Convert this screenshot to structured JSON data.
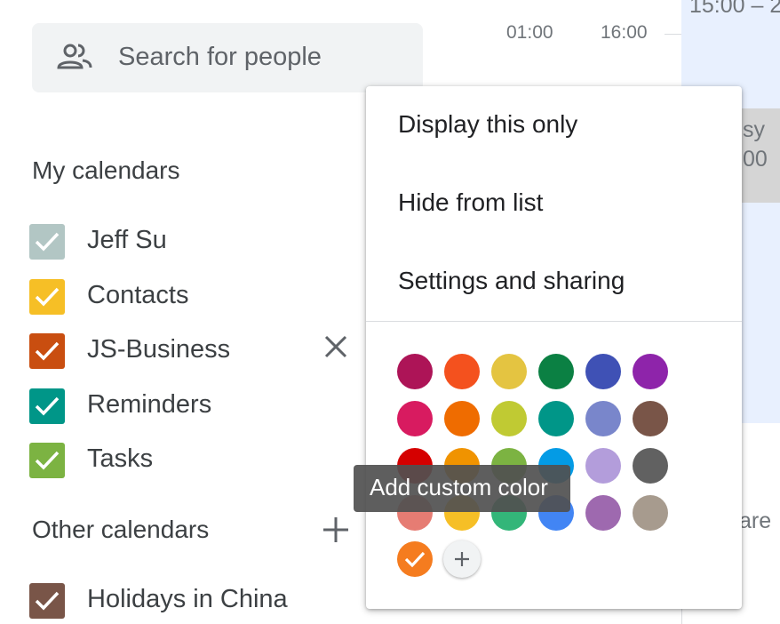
{
  "search": {
    "placeholder": "Search for people"
  },
  "timeline": {
    "labels": [
      "01:00",
      "16:00"
    ],
    "top_fragment": "15:00 – 2",
    "event_fragment_1": "sy",
    "event_fragment_2": "00",
    "bottom_fragment": "are"
  },
  "my_calendars": {
    "title": "My calendars",
    "items": [
      {
        "label": "Jeff Su",
        "color": "#b2c6c4",
        "checked": true
      },
      {
        "label": "Contacts",
        "color": "#f6bf26",
        "checked": true
      },
      {
        "label": "JS-Business",
        "color": "#c94e10",
        "checked": true
      },
      {
        "label": "Reminders",
        "color": "#009688",
        "checked": true
      },
      {
        "label": "Tasks",
        "color": "#7cb342",
        "checked": true
      }
    ]
  },
  "other_calendars": {
    "title": "Other calendars",
    "items": [
      {
        "label": "Holidays in China",
        "color": "#795548",
        "checked": true
      }
    ]
  },
  "context_menu": {
    "items": [
      "Display this only",
      "Hide from list",
      "Settings and sharing"
    ],
    "palette": [
      [
        "#ad1457",
        "#f4511e",
        "#e4c441",
        "#0b8043",
        "#3f51b5",
        "#8e24aa"
      ],
      [
        "#d81b60",
        "#ef6c00",
        "#c0ca33",
        "#009688",
        "#7986cb",
        "#795548"
      ],
      [
        "#d50000",
        "#f09300",
        "#7cb342",
        "#039be5",
        "#b39ddb",
        "#616161"
      ],
      [
        "#e67c73",
        "#f6bf26",
        "#33b679",
        "#4285f4",
        "#9e69af",
        "#a79b8e"
      ]
    ],
    "selected_custom_color": "#f57c1f",
    "add_button_icon": "plus-icon",
    "tooltip": "Add custom color"
  }
}
